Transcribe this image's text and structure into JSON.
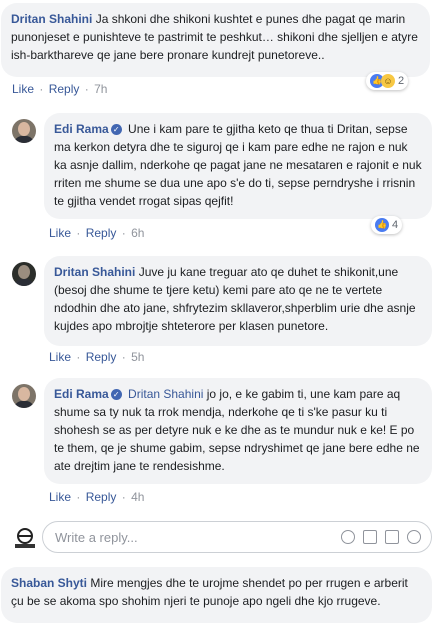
{
  "comments": [
    {
      "author": "Dritan Shahini",
      "mention": "",
      "text": "Ja shkoni dhe shikoni kushtet e punes dhe pagat qe marin punonjeset e punishteve te pastrimit te peshkut… shikoni dhe sjelljen e atyre ish-barkthareve qe jane bere pronare kundrejt punetoreve..",
      "reactions_count": "2",
      "time": "7h"
    },
    {
      "author": "Edi Rama",
      "mention": "",
      "text": "Une i kam pare te gjitha keto qe thua ti Dritan, sepse ma kerkon detyra dhe te siguroj qe i kam pare edhe ne rajon e nuk ka asnje dallim, nderkohe qe pagat jane ne mesataren e rajonit e nuk rriten me shume se dua une apo s'e do ti, sepse perndryshe i rrisnin te gjitha vendet rrogat sipas qejfit!",
      "reactions_count": "4",
      "time": "6h"
    },
    {
      "author": "Dritan Shahini",
      "mention": "",
      "text": "Juve ju kane treguar ato qe duhet te shikonit,une (besoj dhe shume te tjere ketu) kemi pare ato qe ne te vertete ndodhin dhe ato jane, shfrytezim skllaveror,shperblim urie dhe asnje kujdes apo mbrojtje shteterore per klasen punetore.",
      "reactions_count": "",
      "time": "5h"
    },
    {
      "author": "Edi Rama",
      "mention": "Dritan Shahini",
      "text": "jo jo, e ke gabim ti, une kam pare aq shume sa ty nuk ta rrok mendja, nderkohe qe ti s'ke pasur ku ti shohesh se as per detyre nuk e ke dhe as te mundur nuk e ke! E po te them, qe je shume gabim, sepse ndryshimet qe jane bere edhe ne ate drejtim jane te rendesishme.",
      "reactions_count": "",
      "time": "4h"
    }
  ],
  "actions": {
    "like": "Like",
    "reply": "Reply",
    "separator": "·"
  },
  "reply_box": {
    "placeholder": "Write a reply..."
  },
  "bottom_comment": {
    "author": "Shaban Shyti",
    "text": "Mire mengjes dhe te urojme shendet po per rrugen e arberit çu be se akoma spo shohim njeri te punoje apo ngeli dhe kjo rrugeve."
  },
  "colors": {
    "link": "#385898",
    "bubble": "#f2f3f5",
    "meta": "#90949c"
  },
  "icons": {
    "verified": "verified-badge-icon",
    "like_reaction": "like-reaction-icon",
    "haha_reaction": "haha-reaction-icon",
    "emoji": "emoji-icon",
    "camera": "camera-icon",
    "gif": "gif-icon",
    "sticker": "sticker-icon"
  }
}
